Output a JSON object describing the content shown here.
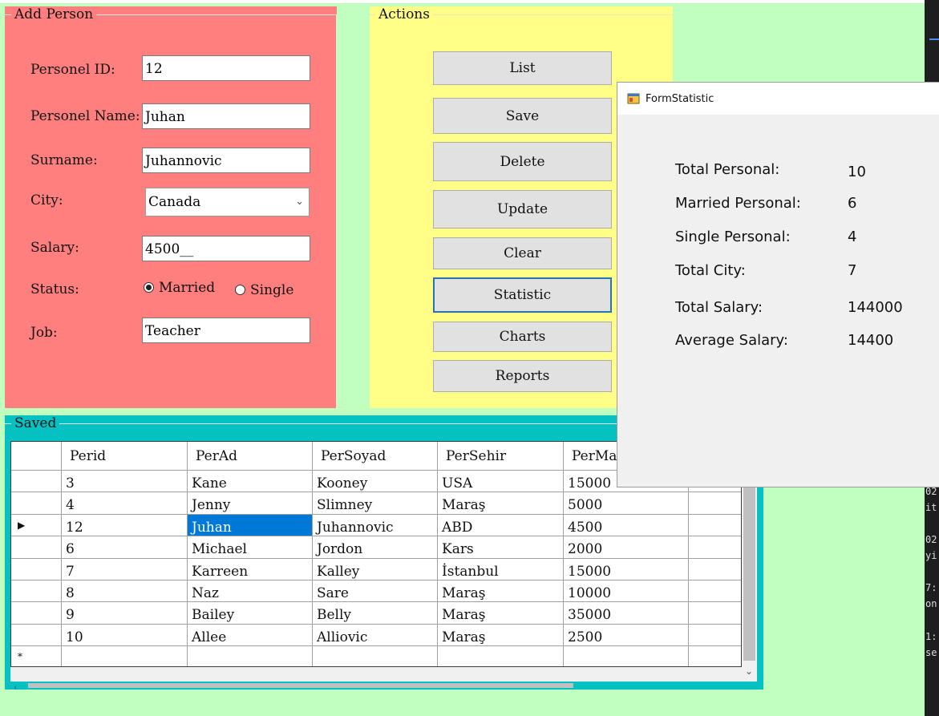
{
  "add_person": {
    "title": "Add Person",
    "labels": {
      "id": "Personel ID:",
      "name": "Personel Name:",
      "surname": "Surname:",
      "city": "City:",
      "salary": "Salary:",
      "status": "Status:",
      "job": "Job:"
    },
    "values": {
      "id": "12",
      "name": "Juhan",
      "surname": "Juhannovic",
      "city": "Canada",
      "salary": "4500__",
      "job": "Teacher"
    },
    "status_options": {
      "married": "Married",
      "single": "Single",
      "selected": "married"
    }
  },
  "actions": {
    "title": "Actions",
    "buttons": [
      "List",
      "Save",
      "Delete",
      "Update",
      "Clear",
      "Statistic",
      "Charts",
      "Reports"
    ]
  },
  "saved": {
    "title": "Saved",
    "columns": [
      "Perid",
      "PerAd",
      "PerSoyad",
      "PerSehir",
      "PerMa"
    ],
    "rows": [
      [
        "3",
        "Kane",
        "Kooney",
        "USA",
        "15000"
      ],
      [
        "4",
        "Jenny",
        "Slimney",
        "Maraş",
        "5000"
      ],
      [
        "12",
        "Juhan",
        "Juhannovic",
        "ABD",
        "4500"
      ],
      [
        "6",
        "Michael",
        "Jordon",
        "Kars",
        "2000"
      ],
      [
        "7",
        "Karreen",
        "Kalley",
        "İstanbul",
        "15000"
      ],
      [
        "8",
        "Naz",
        "Sare",
        "Maraş",
        "10000"
      ],
      [
        "9",
        "Bailey",
        "Belly",
        "Maraş",
        "35000"
      ],
      [
        "10",
        "Allee",
        "Alliovic",
        "Maraş",
        "2500"
      ]
    ],
    "current_row_marker": "▶",
    "new_row_marker": "*"
  },
  "statistic_window": {
    "title": "FormStatistic",
    "labels": [
      "Total Personal:",
      "Married Personal:",
      "Single Personal:",
      "Total City:",
      "Total Salary:",
      "Average Salary:"
    ],
    "values": [
      "10",
      "6",
      "4",
      "7",
      "144000",
      "14400"
    ]
  },
  "background_console": {
    "fragments": [
      "02",
      "it",
      "02",
      "yi",
      "7:",
      "on",
      "1:",
      "se"
    ]
  }
}
